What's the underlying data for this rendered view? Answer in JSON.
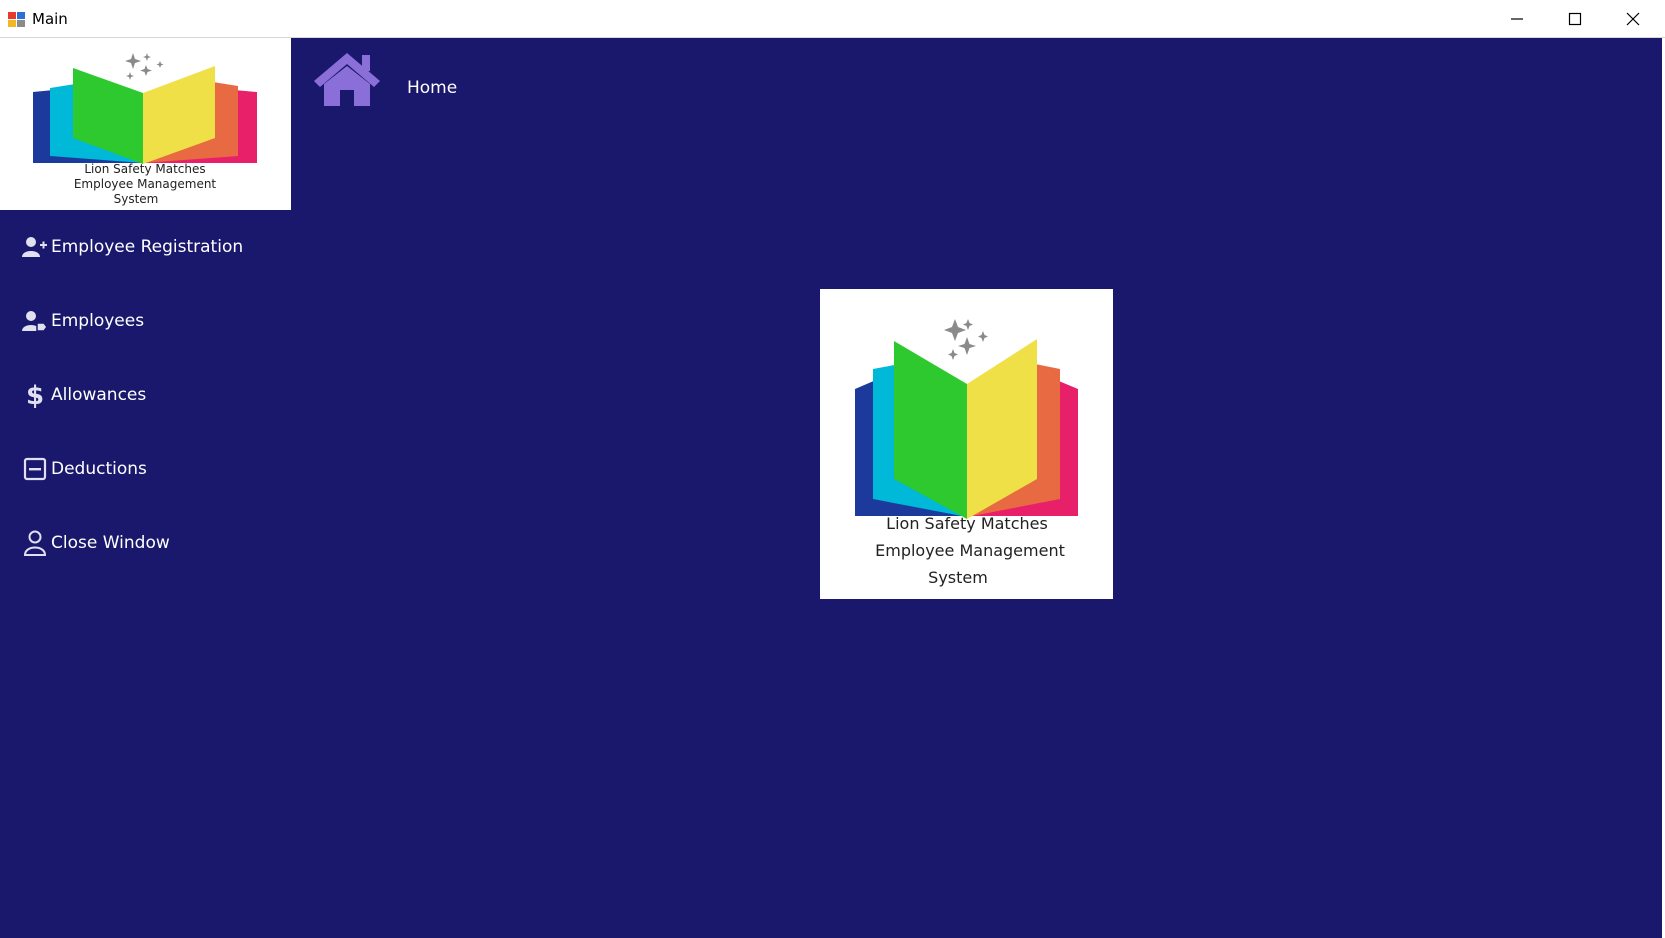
{
  "window": {
    "title": "Main",
    "icon": "winforms-app-icon",
    "controls": [
      "minimize-icon",
      "maximize-icon",
      "close-icon"
    ]
  },
  "logo": {
    "line1": "Lion Safety Matches",
    "line2": "Employee Management",
    "line3": "System"
  },
  "header": {
    "icon": "home-icon",
    "label": "Home"
  },
  "sidebar": {
    "items": [
      {
        "label": "Employee Registration",
        "icon": "user-plus-icon"
      },
      {
        "label": "Employees",
        "icon": "users-tag-icon"
      },
      {
        "label": "Allowances",
        "icon": "dollar-icon"
      },
      {
        "label": "Deductions",
        "icon": "minus-square-icon"
      },
      {
        "label": "Close Window",
        "icon": "user-outline-icon"
      }
    ]
  },
  "colors": {
    "background": "#1a186c",
    "home_icon": "#8b6fd8",
    "sidebar_icon": "#e0e0f0"
  }
}
